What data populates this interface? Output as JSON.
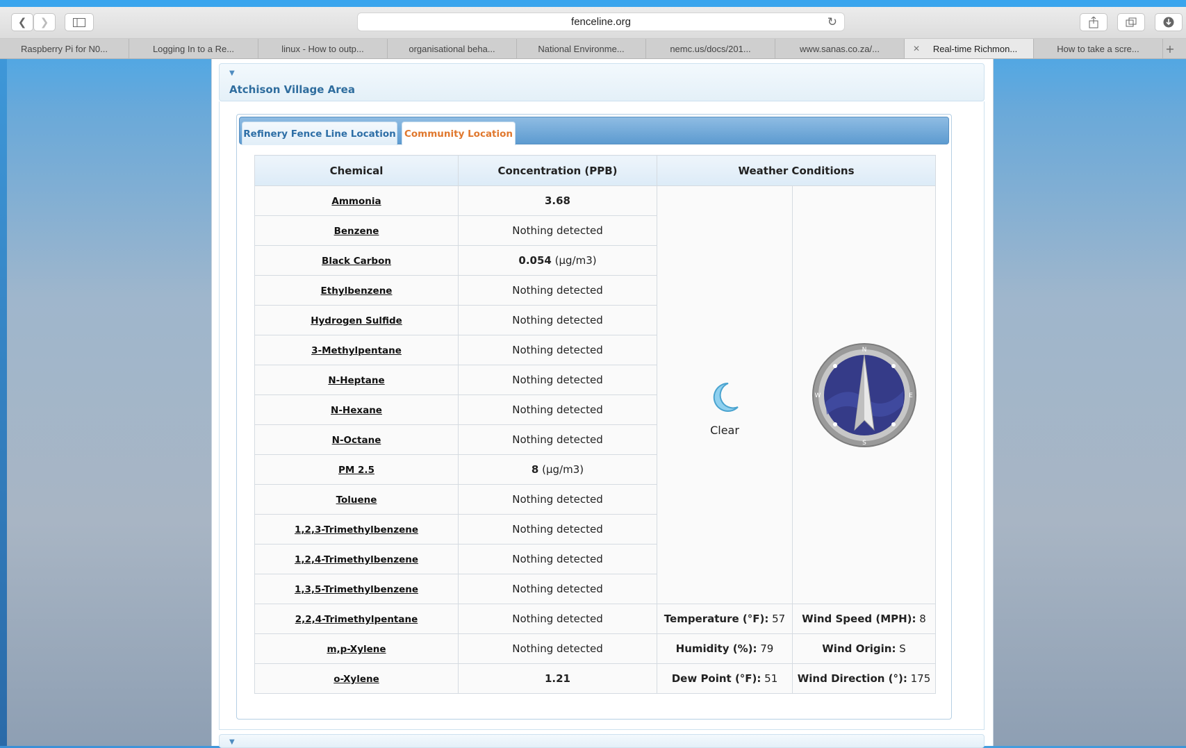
{
  "browser": {
    "url": "fenceline.org",
    "tabs": [
      {
        "label": "Raspberry Pi for N0...",
        "active": false
      },
      {
        "label": "Logging In to a Re...",
        "active": false
      },
      {
        "label": "linux - How to outp...",
        "active": false
      },
      {
        "label": "organisational beha...",
        "active": false
      },
      {
        "label": "National Environme...",
        "active": false
      },
      {
        "label": "nemc.us/docs/201...",
        "active": false
      },
      {
        "label": "www.sanas.co.za/...",
        "active": false
      },
      {
        "label": "Real-time Richmon...",
        "active": true
      },
      {
        "label": "How to take a scre...",
        "active": false
      }
    ],
    "icons": {
      "back": "chevron-left-icon",
      "forward": "chevron-right-icon",
      "sidebar": "sidebar-icon",
      "reload": "reload-icon",
      "share": "share-icon",
      "tabs_overview": "tabs-icon",
      "downloads": "download-icon"
    }
  },
  "section": {
    "title": "Atchison Village Area"
  },
  "location_tabs": [
    {
      "label": "Refinery Fence Line Location",
      "active": false
    },
    {
      "label": "Community Location",
      "active": true
    }
  ],
  "table": {
    "headers": {
      "chemical": "Chemical",
      "concentration": "Concentration (PPB)",
      "weather": "Weather Conditions"
    },
    "rows": [
      {
        "chemical": "Ammonia",
        "value": "3.68",
        "unit": ""
      },
      {
        "chemical": "Benzene",
        "value": "",
        "unit": "Nothing detected"
      },
      {
        "chemical": "Black Carbon",
        "value": "0.054",
        "unit": " (µg/m3)"
      },
      {
        "chemical": "Ethylbenzene",
        "value": "",
        "unit": "Nothing detected"
      },
      {
        "chemical": "Hydrogen Sulfide",
        "value": "",
        "unit": "Nothing detected"
      },
      {
        "chemical": "3-Methylpentane",
        "value": "",
        "unit": "Nothing detected"
      },
      {
        "chemical": "N-Heptane",
        "value": "",
        "unit": "Nothing detected"
      },
      {
        "chemical": "N-Hexane",
        "value": "",
        "unit": "Nothing detected"
      },
      {
        "chemical": "N-Octane",
        "value": "",
        "unit": "Nothing detected"
      },
      {
        "chemical": "PM 2.5",
        "value": "8",
        "unit": " (µg/m3)"
      },
      {
        "chemical": "Toluene",
        "value": "",
        "unit": "Nothing detected"
      },
      {
        "chemical": "1,2,3-Trimethylbenzene",
        "value": "",
        "unit": "Nothing detected"
      },
      {
        "chemical": "1,2,4-Trimethylbenzene",
        "value": "",
        "unit": "Nothing detected"
      },
      {
        "chemical": "1,3,5-Trimethylbenzene",
        "value": "",
        "unit": "Nothing detected"
      },
      {
        "chemical": "2,2,4-Trimethylpentane",
        "value": "",
        "unit": "Nothing detected"
      },
      {
        "chemical": "m,p-Xylene",
        "value": "",
        "unit": "Nothing detected"
      },
      {
        "chemical": "o-Xylene",
        "value": "1.21",
        "unit": ""
      }
    ]
  },
  "weather": {
    "condition": "Clear",
    "condition_icon": "moon-icon",
    "compass_icon": "compass-icon",
    "compass_points": {
      "n": "N",
      "e": "E",
      "s": "S",
      "w": "W"
    },
    "stats": {
      "temperature": {
        "label": "Temperature (°F):",
        "value": " 57"
      },
      "wind_speed": {
        "label": "Wind Speed (MPH):",
        "value": " 8"
      },
      "humidity": {
        "label": "Humidity (%):",
        "value": " 79"
      },
      "wind_origin": {
        "label": "Wind Origin:",
        "value": " S"
      },
      "dew_point": {
        "label": "Dew Point (°F):",
        "value": " 51"
      },
      "wind_direction": {
        "label": "Wind Direction (°):",
        "value": " 175"
      }
    }
  }
}
